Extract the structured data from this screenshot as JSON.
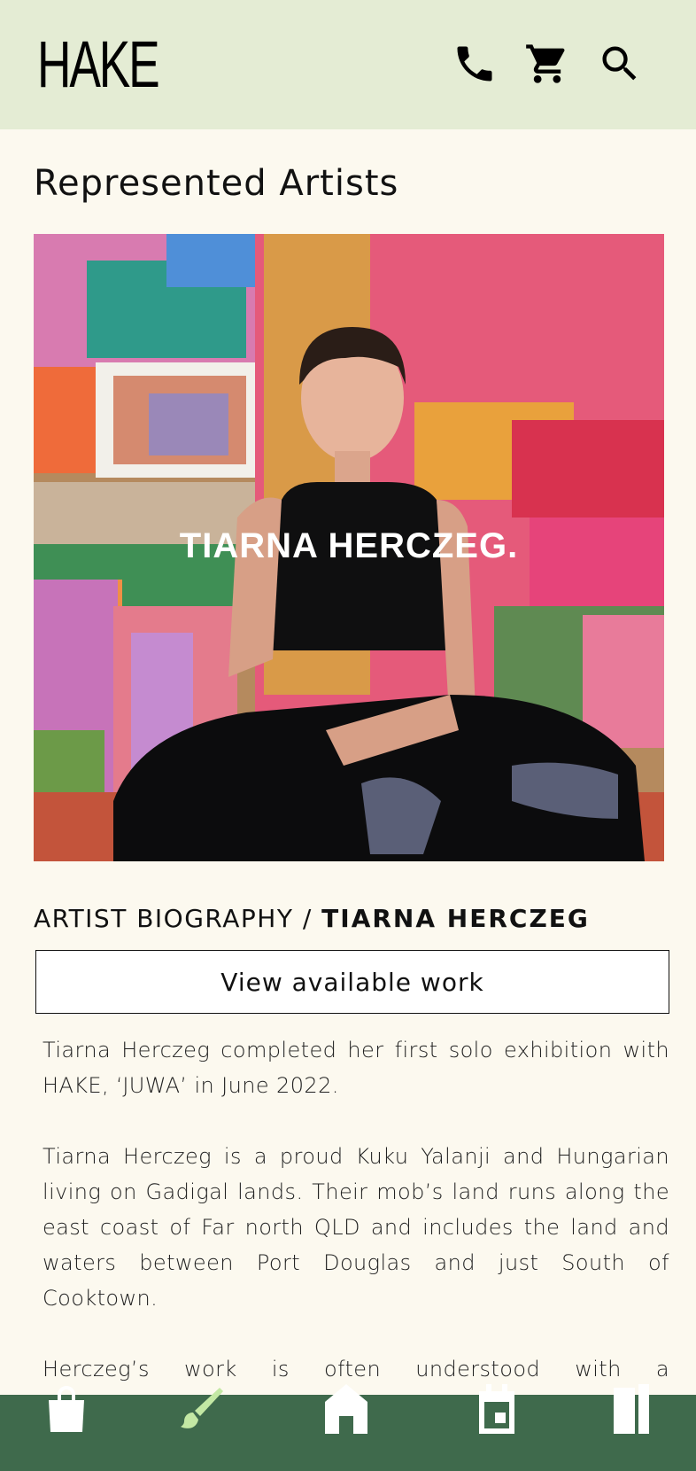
{
  "header": {
    "logo": "HAKE",
    "icons": [
      "phone-icon",
      "cart-icon",
      "search-icon"
    ]
  },
  "page": {
    "section_title": "Represented Artists"
  },
  "hero": {
    "caption": "TIARNA HERCZEG."
  },
  "bio": {
    "heading_prefix": "ARTIST BIOGRAPHY /",
    "artist_name": "TIARNA HERCZEG",
    "view_button": "View available work",
    "paragraphs": [
      "Tiarna Herczeg completed her first solo exhibition with HAKE, ‘JUWA’ in June 2022.",
      "Tiarna Herczeg is a proud Kuku Yalanji and Hungarian living on Gadigal lands. Their mob’s land runs along the east coast of Far north QLD and includes the land and waters between Port Douglas and just South of Cooktown.",
      "Herczeg’s work is often understood with a comprehension of Indigenous, non western maps. Maps that follow paths,"
    ]
  },
  "bottom_nav": {
    "items": [
      {
        "icon": "shopping-bag-icon",
        "active": false
      },
      {
        "icon": "paintbrush-icon",
        "active": true
      },
      {
        "icon": "home-icon",
        "active": false
      },
      {
        "icon": "calendar-icon",
        "active": false
      },
      {
        "icon": "book-icon",
        "active": false
      }
    ],
    "color_bg": "#3f6a4c",
    "color_active": "#c3e8a4",
    "color_inactive": "#ffffff"
  },
  "colors": {
    "header_bg": "#e4ecd4",
    "page_bg": "#fcf9ef"
  }
}
